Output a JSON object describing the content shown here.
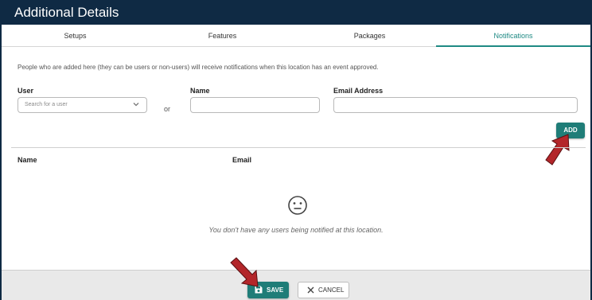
{
  "window": {
    "title": "Additional Details"
  },
  "tabs": [
    {
      "label": "Setups"
    },
    {
      "label": "Features"
    },
    {
      "label": "Packages"
    },
    {
      "label": "Notifications",
      "active": true
    }
  ],
  "info_text": "People who are added here (they can be users or non-users) will receive notifications when this location has an event approved.",
  "form": {
    "user_label": "User",
    "user_placeholder": "Search for a user",
    "or_text": "or",
    "name_label": "Name",
    "name_value": "",
    "email_label": "Email Address",
    "email_value": "",
    "add_label": "ADD"
  },
  "table": {
    "col_name": "Name",
    "col_email": "Email",
    "empty_icon": "neutral-face-icon",
    "empty_message": "You don't have any users being notified at this location."
  },
  "footer": {
    "save_label": "SAVE",
    "cancel_label": "CANCEL"
  },
  "colors": {
    "header": "#0f2a44",
    "accent": "#1f7d78",
    "arrow": "#b3262a"
  },
  "icons": {
    "save": "floppy-disk-icon",
    "cancel": "close-icon",
    "dropdown": "chevron-down-icon",
    "annotation": "red-arrow-icon"
  }
}
